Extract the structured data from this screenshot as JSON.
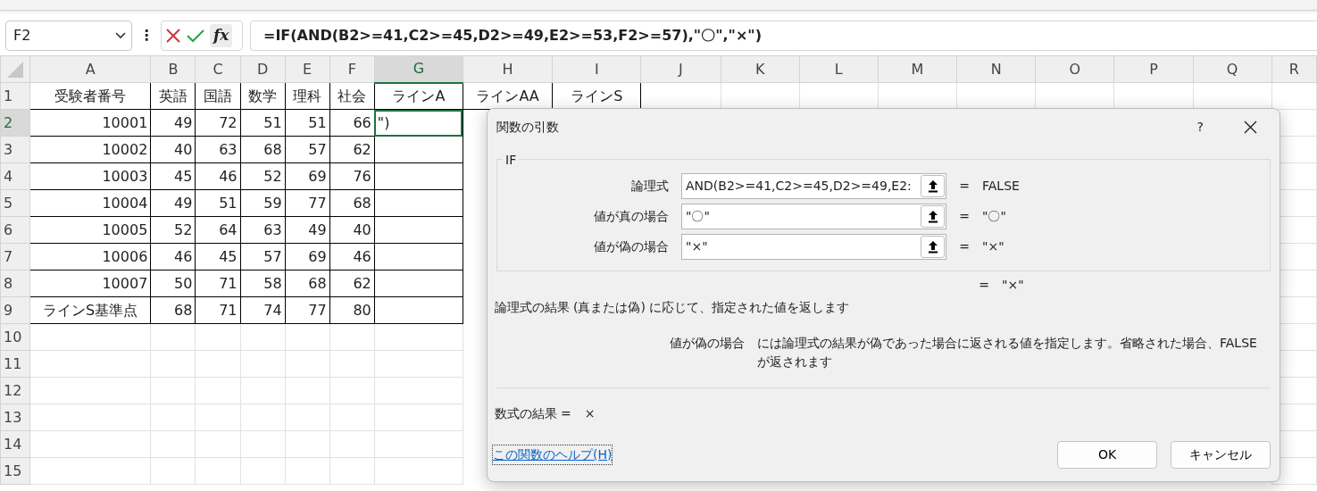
{
  "name_box": {
    "value": "F2"
  },
  "formula_bar": {
    "more": "⋮",
    "fx": "fx",
    "formula": "=IF(AND(B2>=41,C2>=45,D2>=49,E2>=53,F2>=57),\"〇\",\"×\")"
  },
  "sheet": {
    "columns": [
      {
        "label": "A",
        "selected": false
      },
      {
        "label": "B",
        "selected": false
      },
      {
        "label": "C",
        "selected": false
      },
      {
        "label": "D",
        "selected": false
      },
      {
        "label": "E",
        "selected": false
      },
      {
        "label": "F",
        "selected": false
      },
      {
        "label": "G",
        "selected": true
      },
      {
        "label": "H",
        "selected": false
      },
      {
        "label": "I",
        "selected": false
      },
      {
        "label": "J",
        "selected": false
      },
      {
        "label": "K",
        "selected": false
      },
      {
        "label": "L",
        "selected": false
      },
      {
        "label": "M",
        "selected": false
      },
      {
        "label": "N",
        "selected": false
      },
      {
        "label": "O",
        "selected": false
      },
      {
        "label": "P",
        "selected": false
      },
      {
        "label": "Q",
        "selected": false
      },
      {
        "label": "R",
        "selected": false
      }
    ],
    "rows": [
      {
        "number": "1",
        "selected": false,
        "cells": [
          "受験者番号",
          "英語",
          "国語",
          "数学",
          "理科",
          "社会",
          "ラインA",
          "ラインAA",
          "ラインS"
        ]
      },
      {
        "number": "2",
        "selected": true,
        "cells": [
          "10001",
          "49",
          "72",
          "51",
          "51",
          "66",
          "\")"
        ]
      },
      {
        "number": "3",
        "selected": false,
        "cells": [
          "10002",
          "40",
          "63",
          "68",
          "57",
          "62"
        ]
      },
      {
        "number": "4",
        "selected": false,
        "cells": [
          "10003",
          "45",
          "46",
          "52",
          "69",
          "76"
        ]
      },
      {
        "number": "5",
        "selected": false,
        "cells": [
          "10004",
          "49",
          "51",
          "59",
          "77",
          "68"
        ]
      },
      {
        "number": "6",
        "selected": false,
        "cells": [
          "10005",
          "52",
          "64",
          "63",
          "49",
          "40"
        ]
      },
      {
        "number": "7",
        "selected": false,
        "cells": [
          "10006",
          "46",
          "45",
          "57",
          "69",
          "46"
        ]
      },
      {
        "number": "8",
        "selected": false,
        "cells": [
          "10007",
          "50",
          "71",
          "58",
          "68",
          "62"
        ]
      },
      {
        "number": "9",
        "selected": false,
        "cells": [
          "ラインS基準点",
          "68",
          "71",
          "74",
          "77",
          "80"
        ]
      },
      {
        "number": "10",
        "selected": false,
        "cells": []
      },
      {
        "number": "11",
        "selected": false,
        "cells": []
      },
      {
        "number": "12",
        "selected": false,
        "cells": []
      },
      {
        "number": "13",
        "selected": false,
        "cells": []
      },
      {
        "number": "14",
        "selected": false,
        "cells": []
      },
      {
        "number": "15",
        "selected": false,
        "cells": []
      }
    ]
  },
  "dialog": {
    "title": "関数の引数",
    "help": "?",
    "group": "IF",
    "arguments": [
      {
        "label": "論理式",
        "value": "AND(B2>=41,C2>=45,D2>=49,E2:",
        "equals": "=",
        "result": "FALSE"
      },
      {
        "label": "値が真の場合",
        "value": "\"〇\"",
        "equals": "=",
        "result": "\"〇\""
      },
      {
        "label": "値が偽の場合",
        "value": "\"×\"",
        "equals": "=",
        "result": "\"×\""
      }
    ],
    "result_equals": "=",
    "result": "\"×\"",
    "description": "論理式の結果 (真または偽) に応じて、指定された値を返します",
    "argument_help": {
      "label": "値が偽の場合",
      "text": "には論理式の結果が偽であった場合に返される値を指定します。省略された場合、FALSE が返されます"
    },
    "formula_result": {
      "label": "数式の結果 =",
      "value": "×"
    },
    "help_link": "この関数のヘルプ(H)",
    "buttons": [
      "OK",
      "キャンセル"
    ]
  }
}
